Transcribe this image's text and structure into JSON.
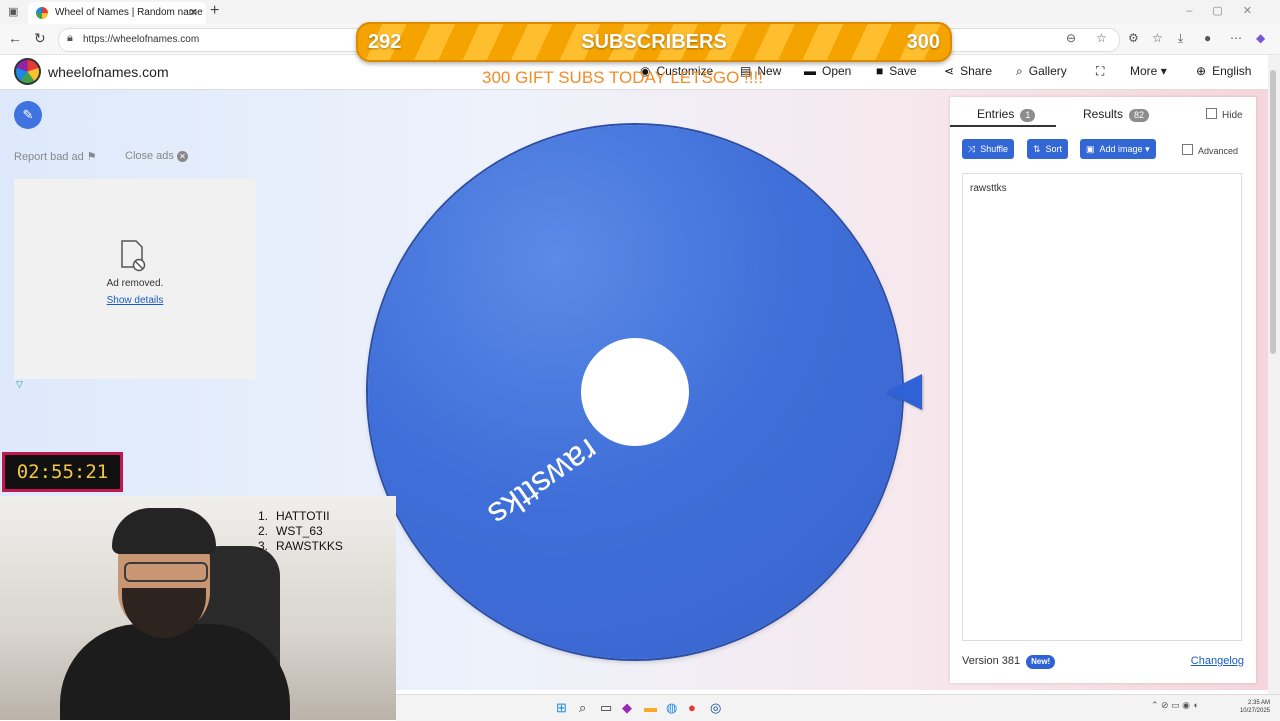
{
  "browser": {
    "tab_title": "Wheel of Names | Random name",
    "tab_close_icon": "close-icon",
    "new_tab_icon": "plus-icon",
    "url": "https://wheelofnames.com"
  },
  "overlay": {
    "sub_current": "292",
    "sub_label": "SUBSCRIBERS",
    "sub_goal": "300",
    "gift_subs": "300 GIFT SUBS TODAY LETSGO !!!!",
    "timer": "02:55:21",
    "winners": [
      {
        "num": "1.",
        "name": "HATTOTII"
      },
      {
        "num": "2.",
        "name": "WST_63"
      },
      {
        "num": "3.",
        "name": "RAWSTKKS"
      }
    ]
  },
  "site": {
    "name": "wheelofnames.com",
    "menu": {
      "customize": "Customize",
      "new": "New",
      "open": "Open",
      "save": "Save",
      "share": "Share",
      "gallery": "Gallery",
      "more": "More",
      "language": "English"
    }
  },
  "ads": {
    "report": "Report bad ad",
    "close": "Close ads",
    "removed": "Ad removed.",
    "details": "Show details"
  },
  "wheel": {
    "label": "rawsttks",
    "color": "#3f6fd8"
  },
  "panel": {
    "tab_entries": "Entries",
    "entries_count": "1",
    "tab_results": "Results",
    "results_count": "82",
    "hide": "Hide",
    "shuffle": "Shuffle",
    "sort": "Sort",
    "add_image": "Add image",
    "advanced": "Advanced",
    "entry": "rawsttks",
    "version": "Version 381",
    "new_badge": "New!",
    "changelog": "Changelog"
  },
  "system": {
    "time": "2:35 AM",
    "date": "10/27/2025"
  }
}
